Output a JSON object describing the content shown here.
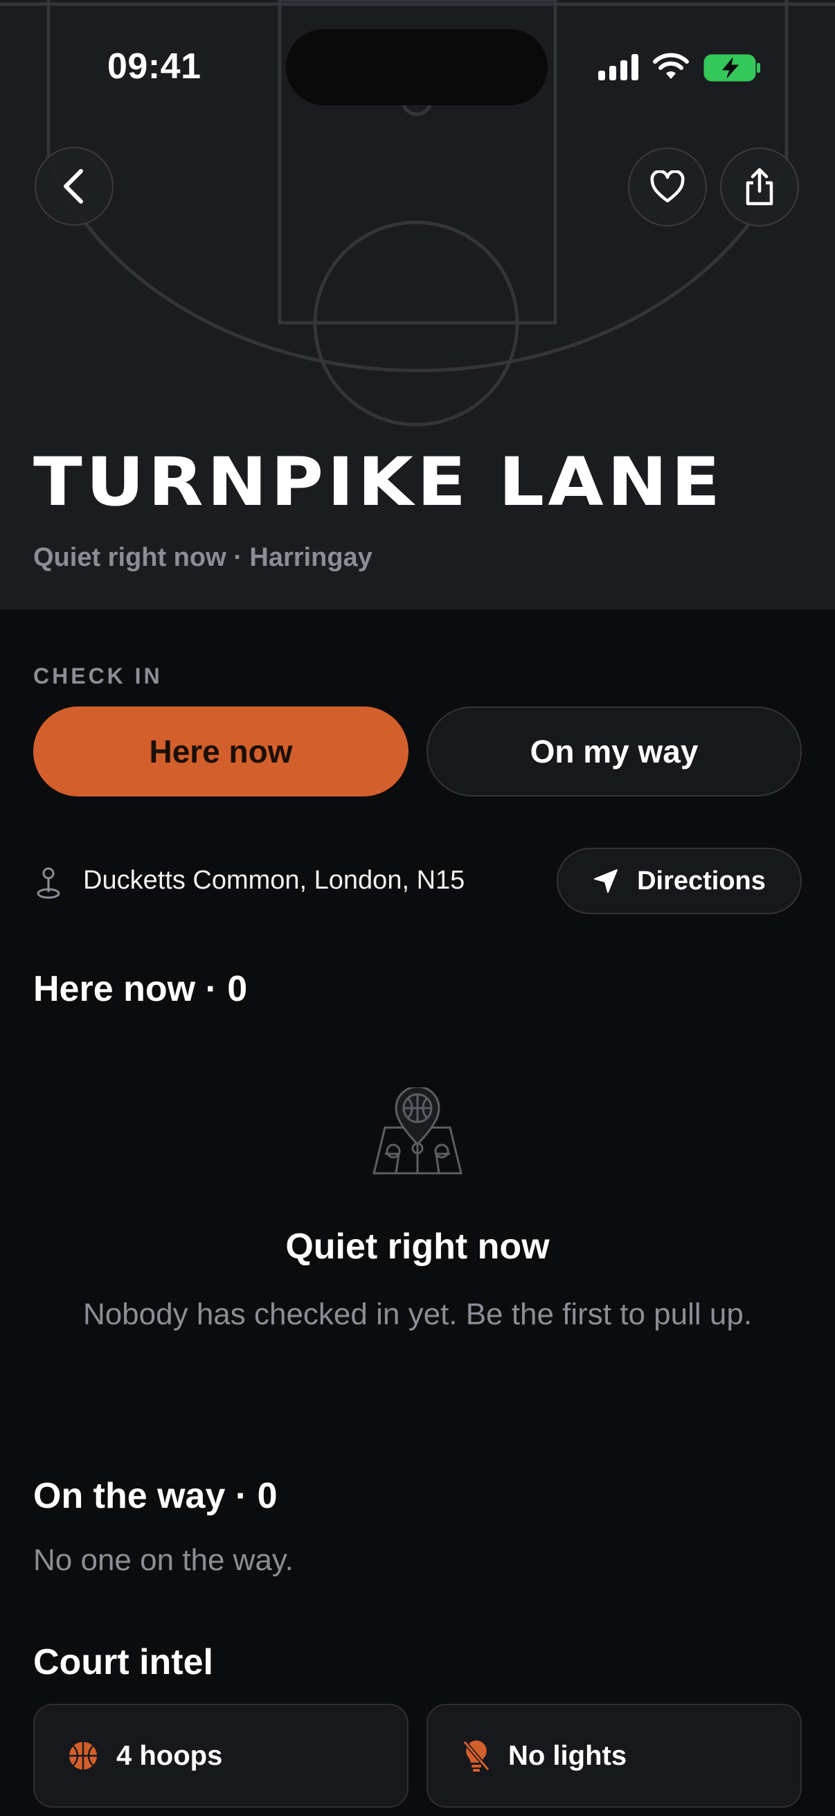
{
  "status_bar": {
    "time": "09:41"
  },
  "court": {
    "name": "TURNPIKE LANE",
    "subtitle": "Quiet right now · Harringay"
  },
  "check_in": {
    "label": "CHECK IN",
    "here_now_label": "Here now",
    "on_my_way_label": "On my way"
  },
  "location": {
    "address": "Ducketts Common, London, N15",
    "directions_label": "Directions"
  },
  "here_now": {
    "heading": "Here now · 0",
    "empty_title": "Quiet right now",
    "empty_description": "Nobody has checked in yet. Be the first to pull up."
  },
  "on_the_way": {
    "heading": "On the way · 0",
    "empty_text": "No one on the way."
  },
  "court_intel": {
    "heading": "Court intel",
    "items": [
      {
        "label": "4 hoops",
        "icon": "basketball-icon"
      },
      {
        "label": "No lights",
        "icon": "lightbulb-off-icon"
      }
    ]
  },
  "colors": {
    "accent": "#d35f2c",
    "background": "#0b0c0e",
    "hero_background": "#1b1c20",
    "muted_text": "#8c8e96",
    "battery_green": "#34c759"
  }
}
